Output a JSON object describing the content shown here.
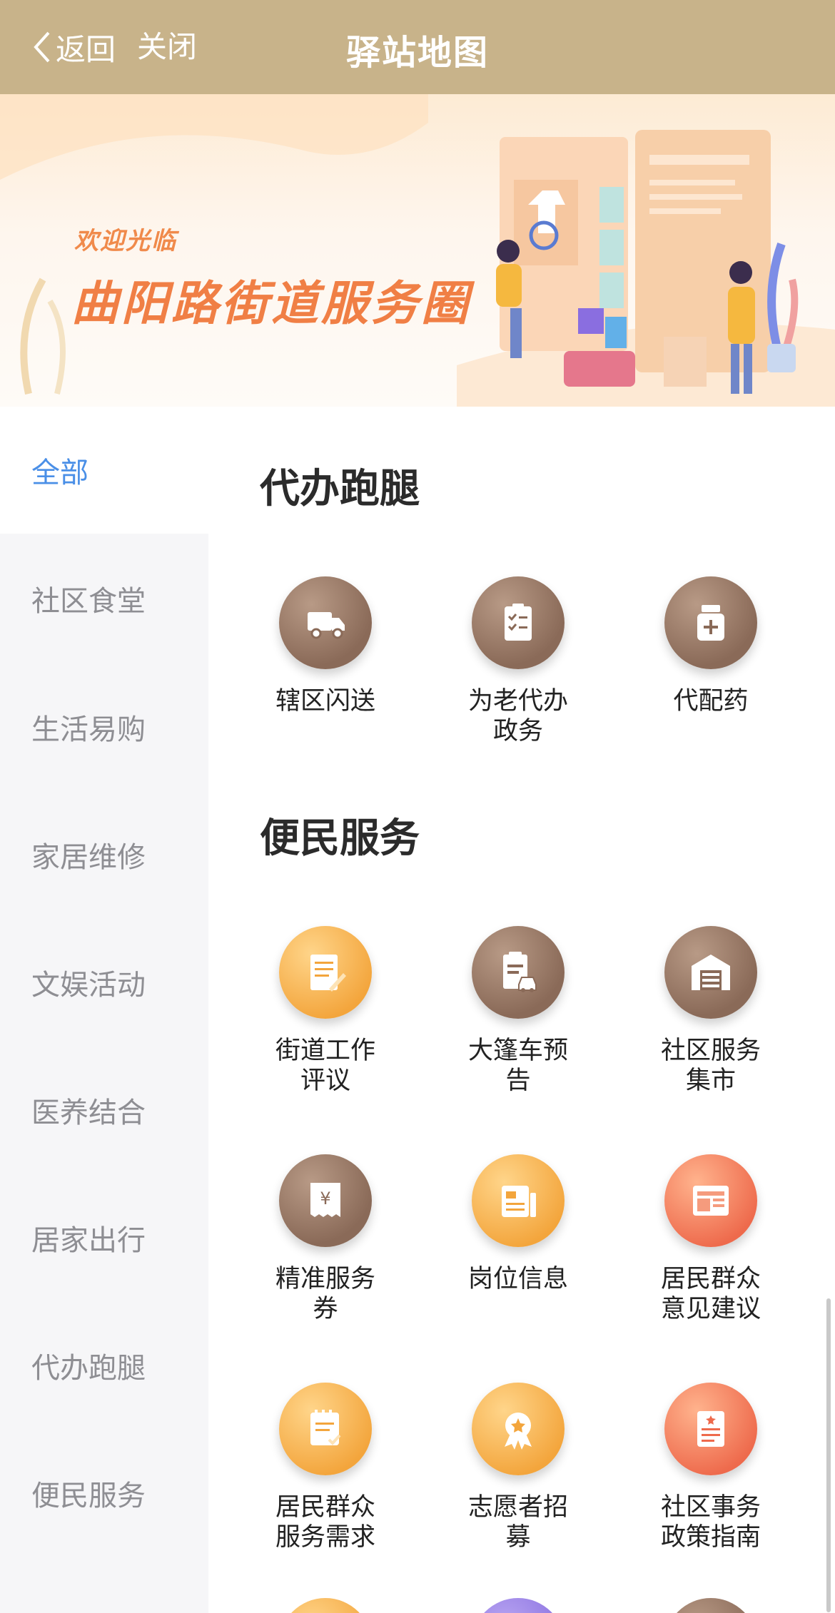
{
  "header": {
    "back_label": "返回",
    "close_label": "关闭",
    "title": "驿站地图"
  },
  "banner": {
    "welcome": "欢迎光临",
    "headline": "曲阳路街道服务圈"
  },
  "sidebar": {
    "items": [
      {
        "label": "全部",
        "active": true
      },
      {
        "label": "社区食堂"
      },
      {
        "label": "生活易购"
      },
      {
        "label": "家居维修"
      },
      {
        "label": "文娱活动"
      },
      {
        "label": "医养结合"
      },
      {
        "label": "居家出行"
      },
      {
        "label": "代办跑腿"
      },
      {
        "label": "便民服务"
      }
    ]
  },
  "sections": [
    {
      "title": "代办跑腿",
      "items": [
        {
          "label": "辖区闪送",
          "icon": "truck-icon",
          "color": "brown"
        },
        {
          "label": "为老代办政务",
          "icon": "clipboard-checklist-icon",
          "color": "brown"
        },
        {
          "label": "代配药",
          "icon": "medicine-bottle-icon",
          "color": "brown"
        }
      ]
    },
    {
      "title": "便民服务",
      "items": [
        {
          "label": "街道工作评议",
          "icon": "document-pen-icon",
          "color": "orange"
        },
        {
          "label": "大篷车预告",
          "icon": "document-car-icon",
          "color": "brown"
        },
        {
          "label": "社区服务集市",
          "icon": "warehouse-icon",
          "color": "brown"
        },
        {
          "label": "精准服务券",
          "icon": "yen-voucher-icon",
          "color": "brown"
        },
        {
          "label": "岗位信息",
          "icon": "newspaper-icon",
          "color": "orange"
        },
        {
          "label": "居民群众意见建议",
          "icon": "layout-window-icon",
          "color": "red"
        },
        {
          "label": "居民群众服务需求",
          "icon": "notepad-check-icon",
          "color": "orange"
        },
        {
          "label": "志愿者招募",
          "icon": "award-medal-icon",
          "color": "orange"
        },
        {
          "label": "社区事务政策指南",
          "icon": "policy-document-icon",
          "color": "red"
        }
      ]
    }
  ],
  "colors": {
    "header": "#c8b38a",
    "active": "#4a8fe7",
    "sidebar_bg": "#f6f6f8"
  }
}
